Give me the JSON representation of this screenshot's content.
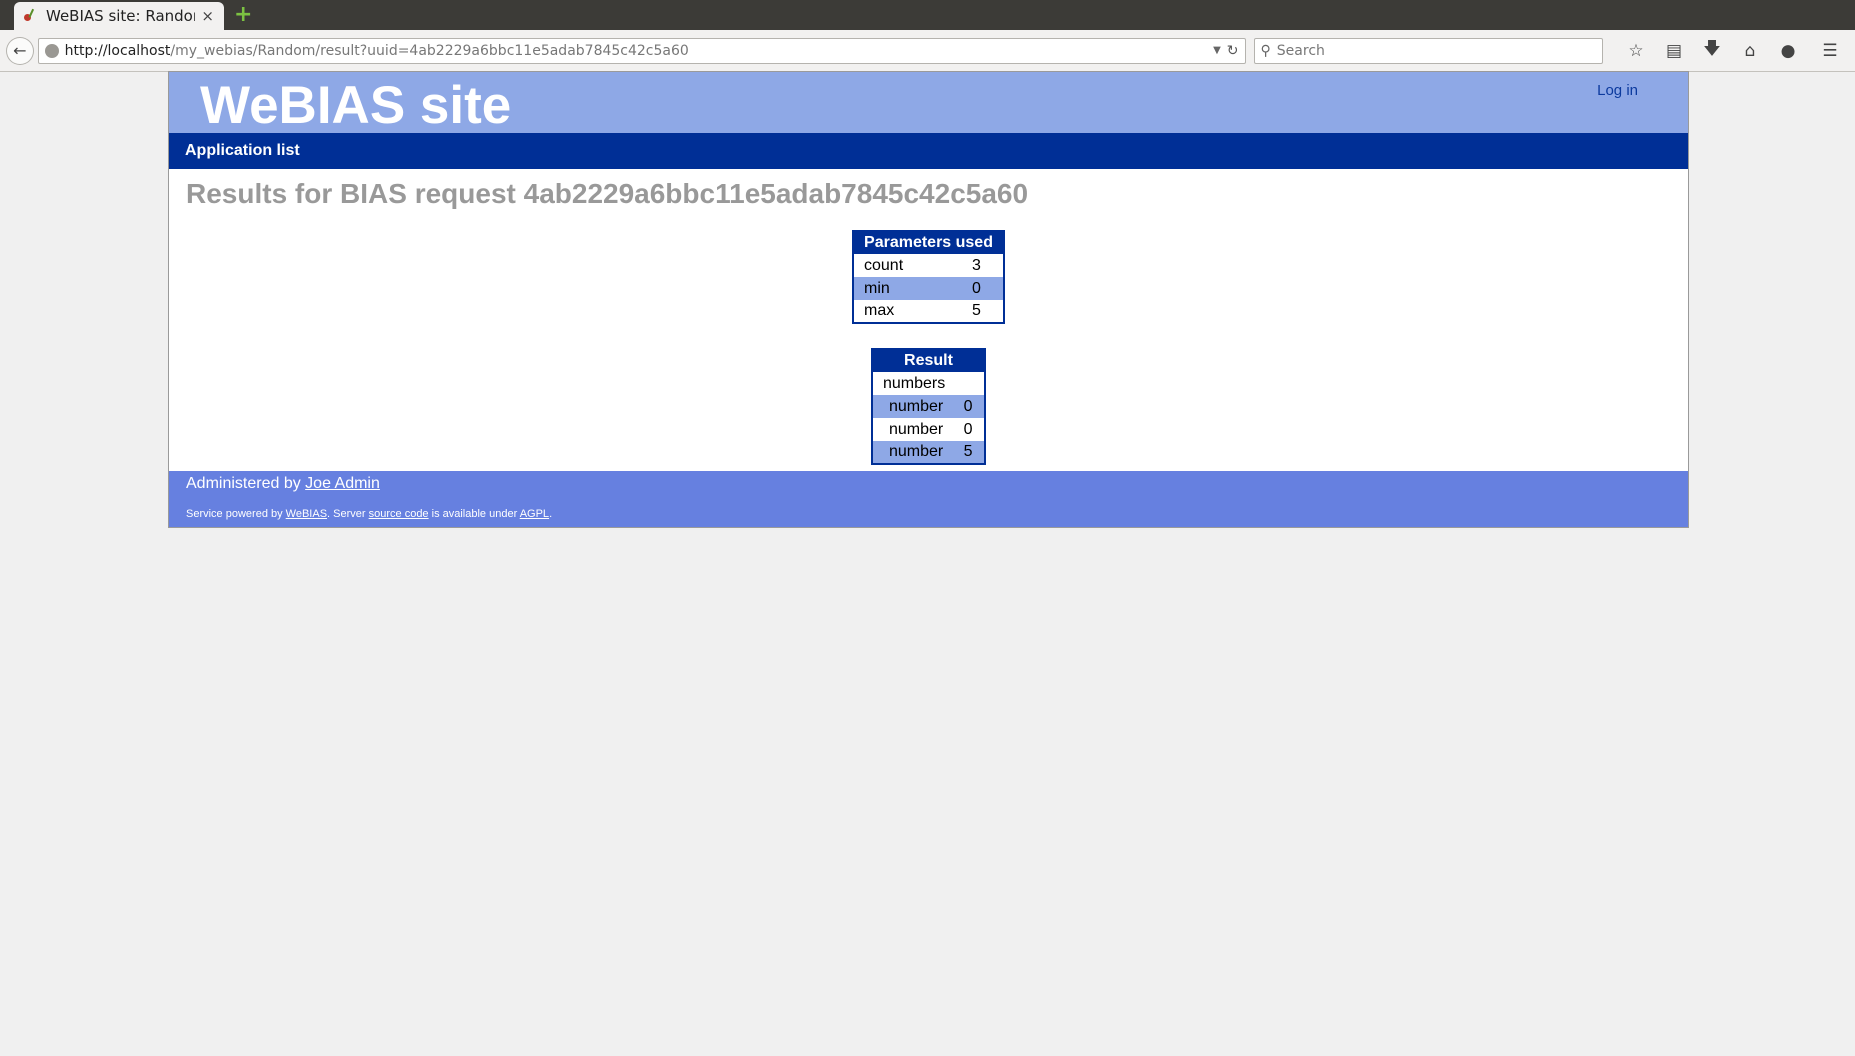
{
  "browser": {
    "tab_title": "WeBIAS site: Random",
    "tab_close": "×",
    "new_tab": "+",
    "url_host": "http://localhost",
    "url_path": "/my_webias/Random/result?uuid=4ab2229a6bbc11e5adab7845c42c5a60",
    "search_placeholder": "Search"
  },
  "header": {
    "site_title": "WeBIAS site",
    "login_label": "Log in"
  },
  "nav": {
    "app_list_label": "Application list"
  },
  "main": {
    "title": "Results for BIAS request 4ab2229a6bbc11e5adab7845c42c5a60",
    "parameters": {
      "heading": "Parameters used",
      "rows": [
        {
          "name": "count",
          "value": "3"
        },
        {
          "name": "min",
          "value": "0"
        },
        {
          "name": "max",
          "value": "5"
        }
      ]
    },
    "result": {
      "heading": "Result",
      "group_label": "numbers",
      "rows": [
        {
          "name": "number",
          "value": "0"
        },
        {
          "name": "number",
          "value": "0"
        },
        {
          "name": "number",
          "value": "5"
        }
      ]
    }
  },
  "footer": {
    "admin_prefix": "Administered by",
    "admin_name": "Joe Admin",
    "powered_1": "Service powered by",
    "webias_link": "WeBIAS",
    "powered_2": ". Server",
    "source_link": "source code",
    "powered_3": "is available under",
    "agpl_link": "AGPL",
    "powered_4": "."
  }
}
